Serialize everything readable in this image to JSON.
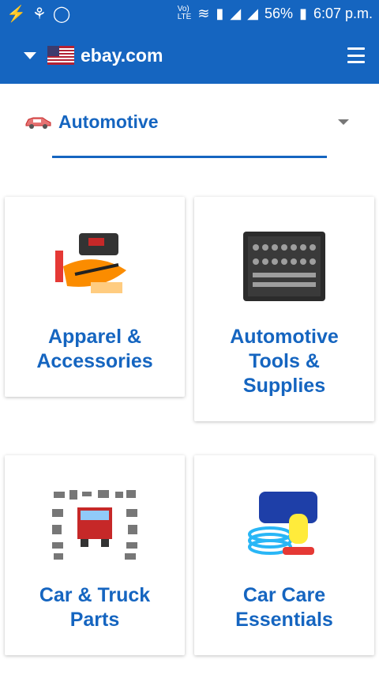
{
  "status_bar": {
    "left_icons": [
      "flash-icon",
      "usb-icon",
      "whatsapp-icon"
    ],
    "right_icons": [
      "volte-icon",
      "wifi-icon",
      "sim-icon",
      "signal-icon",
      "signal-icon"
    ],
    "battery": "56%",
    "time": "6:07 p.m."
  },
  "app_bar": {
    "site": "ebay.com",
    "flag_icon": "us-flag-icon",
    "menu_icon": "hamburger-menu-icon",
    "color": "#1565c0"
  },
  "category_selector": {
    "label": "Automotive",
    "icon": "car-icon"
  },
  "tiles": [
    {
      "title": "Apparel & Accessories",
      "image": "emergency-kit-image"
    },
    {
      "title": "Automotive Tools & Supplies",
      "image": "socket-set-image"
    },
    {
      "title": "Car & Truck Parts",
      "image": "truck-parts-image"
    },
    {
      "title": "Car Care Essentials",
      "image": "car-care-kit-image"
    }
  ]
}
